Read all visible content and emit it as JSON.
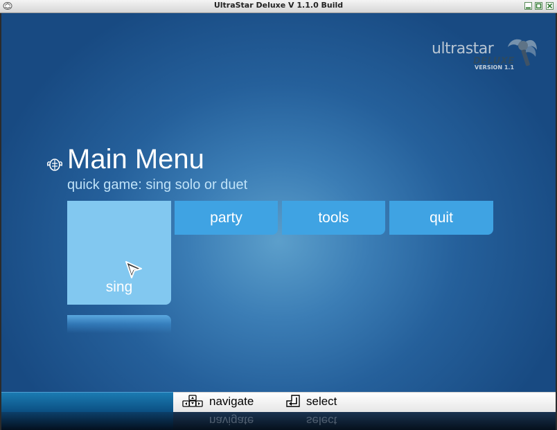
{
  "window": {
    "title": "UltraStar Deluxe V 1.1.0 Build",
    "controls": [
      "minimize-icon",
      "maximize-icon",
      "close-icon"
    ]
  },
  "logo": {
    "name": "ultrastar",
    "edition": "DELUXE",
    "version": "VERSION 1.1"
  },
  "menu": {
    "title": "Main Menu",
    "description": "quick game: sing solo or duet",
    "buttons": [
      {
        "id": "sing",
        "label": "sing",
        "selected": true
      },
      {
        "id": "party",
        "label": "party",
        "selected": false
      },
      {
        "id": "tools",
        "label": "tools",
        "selected": false
      },
      {
        "id": "quit",
        "label": "quit",
        "selected": false
      }
    ]
  },
  "hints": {
    "navigate": "navigate",
    "select": "select"
  },
  "colors": {
    "button": "#3fa3e3",
    "button_selected": "#82c8f0",
    "background_center": "#5c9fcb",
    "background_edge": "#184a82"
  }
}
